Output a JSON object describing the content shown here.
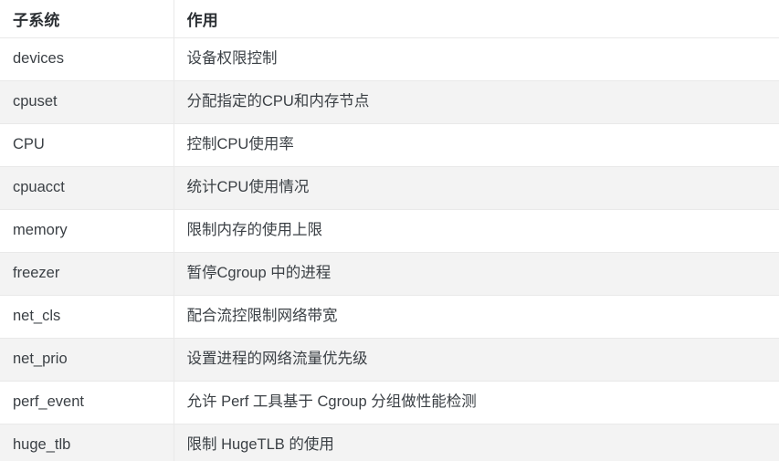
{
  "table": {
    "columns": [
      {
        "key": "subsystem",
        "label": "子系统"
      },
      {
        "key": "function",
        "label": "作用"
      }
    ],
    "rows": [
      {
        "subsystem": "devices",
        "function": "设备权限控制"
      },
      {
        "subsystem": "cpuset",
        "function": "分配指定的CPU和内存节点"
      },
      {
        "subsystem": "CPU",
        "function": "控制CPU使用率"
      },
      {
        "subsystem": "cpuacct",
        "function": "统计CPU使用情况"
      },
      {
        "subsystem": "memory",
        "function": "限制内存的使用上限"
      },
      {
        "subsystem": "freezer",
        "function": "暂停Cgroup 中的进程"
      },
      {
        "subsystem": "net_cls",
        "function": "配合流控限制网络带宽"
      },
      {
        "subsystem": "net_prio",
        "function": "设置进程的网络流量优先级"
      },
      {
        "subsystem": "perf_event",
        "function": "允许 Perf 工具基于 Cgroup 分组做性能检测"
      },
      {
        "subsystem": "huge_tlb",
        "function": "限制 HugeTLB 的使用"
      }
    ],
    "colors": {
      "header_text": "#2b2f33",
      "body_text": "#3b4045",
      "row_background": "#ffffff",
      "row_background_striped": "#f3f3f3",
      "border": "#e9e9e9"
    }
  }
}
